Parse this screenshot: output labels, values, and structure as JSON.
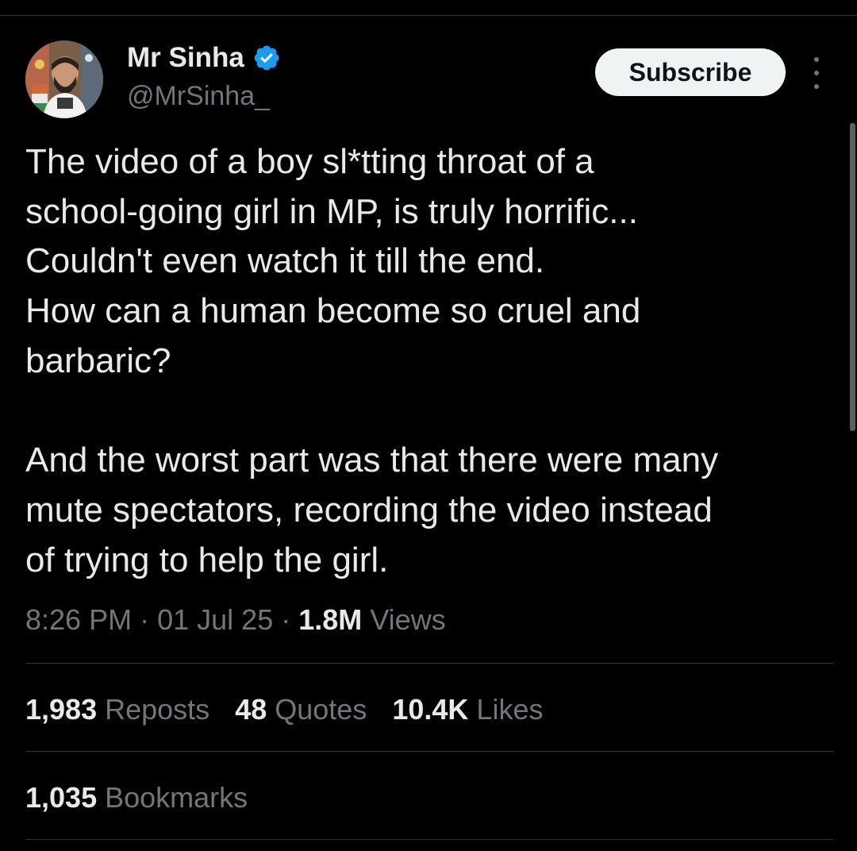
{
  "author": {
    "display_name": "Mr Sinha",
    "handle": "@MrSinha_",
    "verified": true
  },
  "actions": {
    "subscribe_label": "Subscribe",
    "more_icon": "more-vertical-icon"
  },
  "tweet": {
    "text": "The video of a boy sl*tting throat of a\nschool-going girl in MP, is truly horrific...\nCouldn't even watch it till the end.\nHow can a human become so cruel and\nbarbaric?\n\nAnd the worst part was that there were many\nmute spectators, recording the video instead\nof trying to help the girl.",
    "time": "8:26 PM",
    "date": "01 Jul 25",
    "separator": "·",
    "views_count": "1.8M",
    "views_label": "Views"
  },
  "stats": {
    "reposts_count": "1,983",
    "reposts_label": "Reposts",
    "quotes_count": "48",
    "quotes_label": "Quotes",
    "likes_count": "10.4K",
    "likes_label": "Likes",
    "bookmarks_count": "1,035",
    "bookmarks_label": "Bookmarks"
  },
  "colors": {
    "background": "#000000",
    "text": "#e7e9ea",
    "secondary": "#71767b",
    "divider": "#2f3336",
    "verified": "#1d9bf0"
  }
}
